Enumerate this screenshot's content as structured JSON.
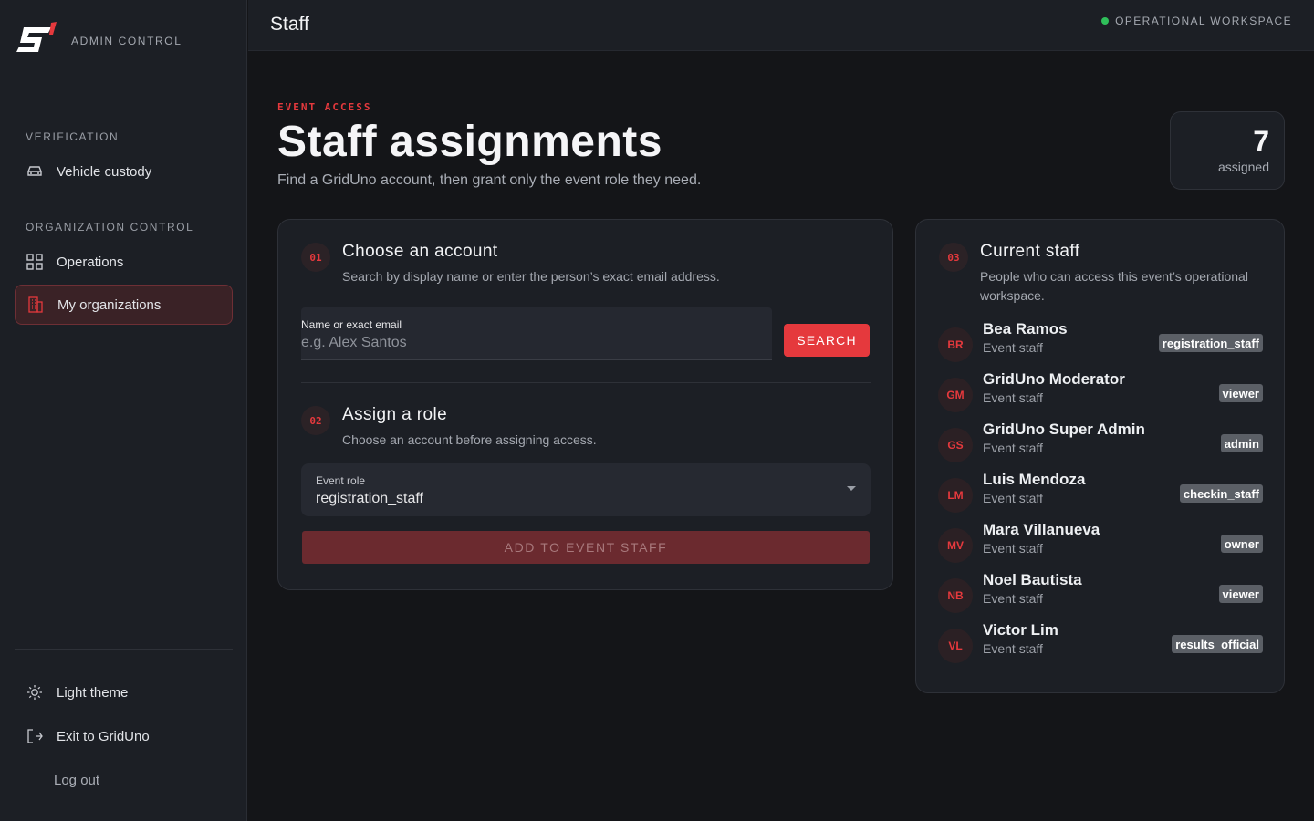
{
  "brand": {
    "label": "ADMIN CONTROL",
    "accent": "#e5393d"
  },
  "sidebar": {
    "section_verification": "VERIFICATION",
    "vehicle_custody": "Vehicle custody",
    "section_org": "ORGANIZATION CONTROL",
    "operations": "Operations",
    "my_organizations": "My organizations",
    "light_theme": "Light theme",
    "exit": "Exit to GridUno",
    "logout": "Log out"
  },
  "topbar": {
    "title": "Staff",
    "status": "OPERATIONAL WORKSPACE",
    "status_color": "#2fbf5a"
  },
  "header": {
    "eyebrow": "EVENT ACCESS",
    "title": "Staff assignments",
    "subtitle": "Find a GridUno account, then grant only the event role they need.",
    "count": "7",
    "count_label": "assigned"
  },
  "choose": {
    "step": "01",
    "title": "Choose an account",
    "desc": "Search by display name or enter the person’s exact email address.",
    "input_label": "Name or exact email",
    "input_placeholder": "e.g. Alex Santos",
    "input_value": "",
    "search_label": "SEARCH"
  },
  "assign": {
    "step": "02",
    "title": "Assign a role",
    "desc": "Choose an account before assigning access.",
    "select_label": "Event role",
    "select_value": "registration_staff",
    "add_label": "ADD TO EVENT STAFF"
  },
  "current": {
    "step": "03",
    "title": "Current staff",
    "desc": "People who can access this event’s operational workspace.",
    "staff": [
      {
        "initials": "BR",
        "name": "Bea Ramos",
        "sub": "Event staff",
        "role": "registration_staff"
      },
      {
        "initials": "GM",
        "name": "GridUno Moderator",
        "sub": "Event staff",
        "role": "viewer"
      },
      {
        "initials": "GS",
        "name": "GridUno Super Admin",
        "sub": "Event staff",
        "role": "admin"
      },
      {
        "initials": "LM",
        "name": "Luis Mendoza",
        "sub": "Event staff",
        "role": "checkin_staff"
      },
      {
        "initials": "MV",
        "name": "Mara Villanueva",
        "sub": "Event staff",
        "role": "owner"
      },
      {
        "initials": "NB",
        "name": "Noel Bautista",
        "sub": "Event staff",
        "role": "viewer"
      },
      {
        "initials": "VL",
        "name": "Victor Lim",
        "sub": "Event staff",
        "role": "results_official"
      }
    ]
  }
}
